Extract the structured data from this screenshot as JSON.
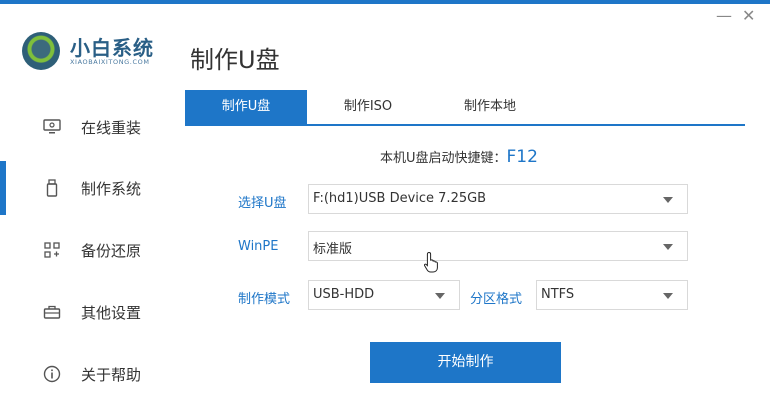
{
  "app": {
    "name_cn": "小白系统",
    "name_en": "XIAOBAIXITONG.COM"
  },
  "page_title": "制作U盘",
  "window": {
    "minimize_icon": "minimize-icon",
    "close_icon": "close-icon",
    "minimize_glyph": "—",
    "close_glyph": "✕"
  },
  "sidebar": {
    "items": [
      {
        "label": "在线重装",
        "icon": "monitor-icon"
      },
      {
        "label": "制作系统",
        "icon": "usb-drive-icon",
        "active": true
      },
      {
        "label": "备份还原",
        "icon": "backup-grid-icon"
      },
      {
        "label": "其他设置",
        "icon": "toolbox-icon"
      },
      {
        "label": "关于帮助",
        "icon": "info-icon"
      }
    ]
  },
  "tabs": [
    {
      "label": "制作U盘",
      "active": true
    },
    {
      "label": "制作ISO"
    },
    {
      "label": "制作本地"
    }
  ],
  "hotkey": {
    "label": "本机U盘启动快捷键：",
    "key": "F12"
  },
  "form": {
    "usb_label": "选择U盘",
    "usb_value": "F:(hd1)USB Device 7.25GB",
    "winpe_label": "WinPE",
    "winpe_value": "标准版",
    "mode_label": "制作模式",
    "mode_value": "USB-HDD",
    "partition_label": "分区格式",
    "partition_value": "NTFS"
  },
  "start_button": "开始制作",
  "colors": {
    "accent": "#1e76c8",
    "text": "#333333"
  }
}
